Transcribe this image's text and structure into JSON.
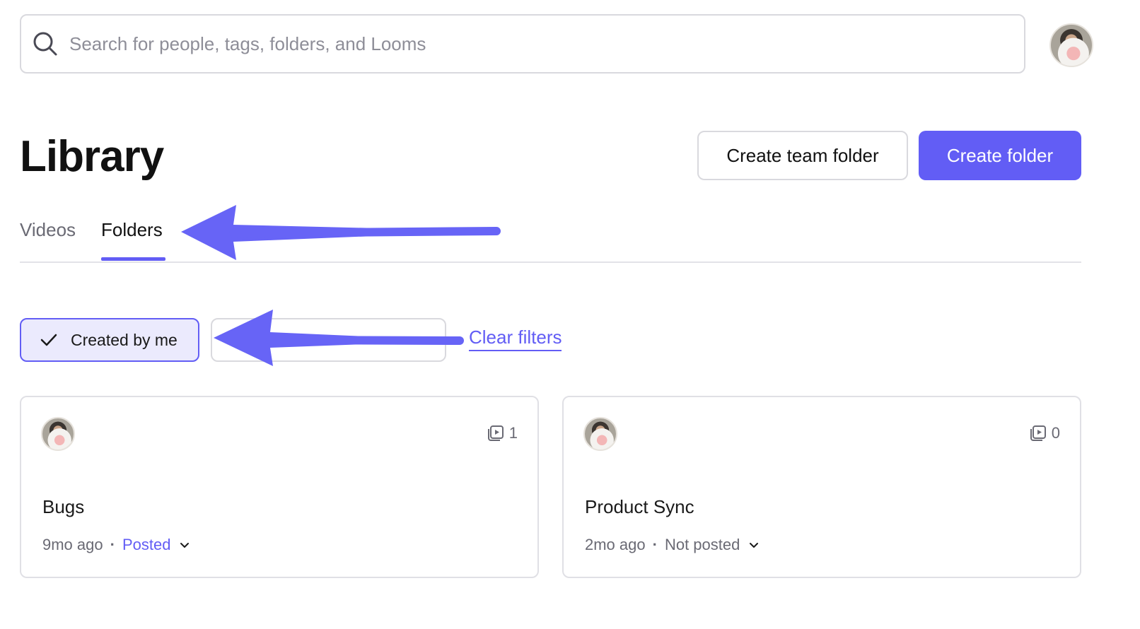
{
  "search": {
    "placeholder": "Search for people, tags, folders, and Looms"
  },
  "header": {
    "title": "Library",
    "create_team_folder_label": "Create team folder",
    "create_folder_label": "Create folder"
  },
  "tabs": [
    {
      "label": "Videos",
      "active": false
    },
    {
      "label": "Folders",
      "active": true
    }
  ],
  "filters": {
    "chips": [
      {
        "label": "Created by me",
        "active": true
      }
    ],
    "clear_label": "Clear filters"
  },
  "folders": [
    {
      "name": "Bugs",
      "age": "9mo ago",
      "status": "Posted",
      "count": "1"
    },
    {
      "name": "Product Sync",
      "age": "2mo ago",
      "status": "Not posted",
      "count": "0"
    }
  ],
  "colors": {
    "accent": "#625df5",
    "annotation_arrow": "#6764f6"
  }
}
